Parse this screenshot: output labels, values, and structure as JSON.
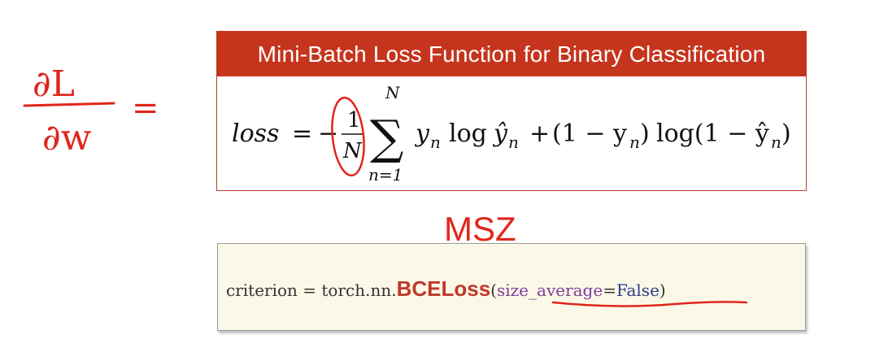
{
  "slide": {
    "title": "Mini-Batch Loss Function for Binary Classification",
    "formula": {
      "lhs": "loss",
      "equals": "=",
      "minus": "−",
      "frac_num": "1",
      "frac_den": "N",
      "sum_upper": "N",
      "sum_lower": "n=1",
      "term1": "y",
      "term1_sub": "n",
      "log1": "log",
      "yhat": "ŷ",
      "yhat_sub": "n",
      "plus": "+",
      "term2": "(1 − y",
      "term2_sub": "n",
      "term2_close": ")",
      "log2": "log(1 − ŷ",
      "log2_sub": "n",
      "log2_close": ")"
    },
    "code": {
      "prefix": "criterion = torch.nn.",
      "class_name": "BCELoss",
      "open_paren": "(",
      "param": "size_average",
      "equals": "=",
      "value": "False",
      "close_paren": ")"
    }
  },
  "annotations": {
    "derivative_num": "∂L",
    "derivative_den": "∂w",
    "derivative_eq": "=",
    "note": "MSZ"
  },
  "colors": {
    "header_bg": "#c5351d",
    "ink_red": "#e0261c",
    "code_bg": "#fcf8e8"
  }
}
